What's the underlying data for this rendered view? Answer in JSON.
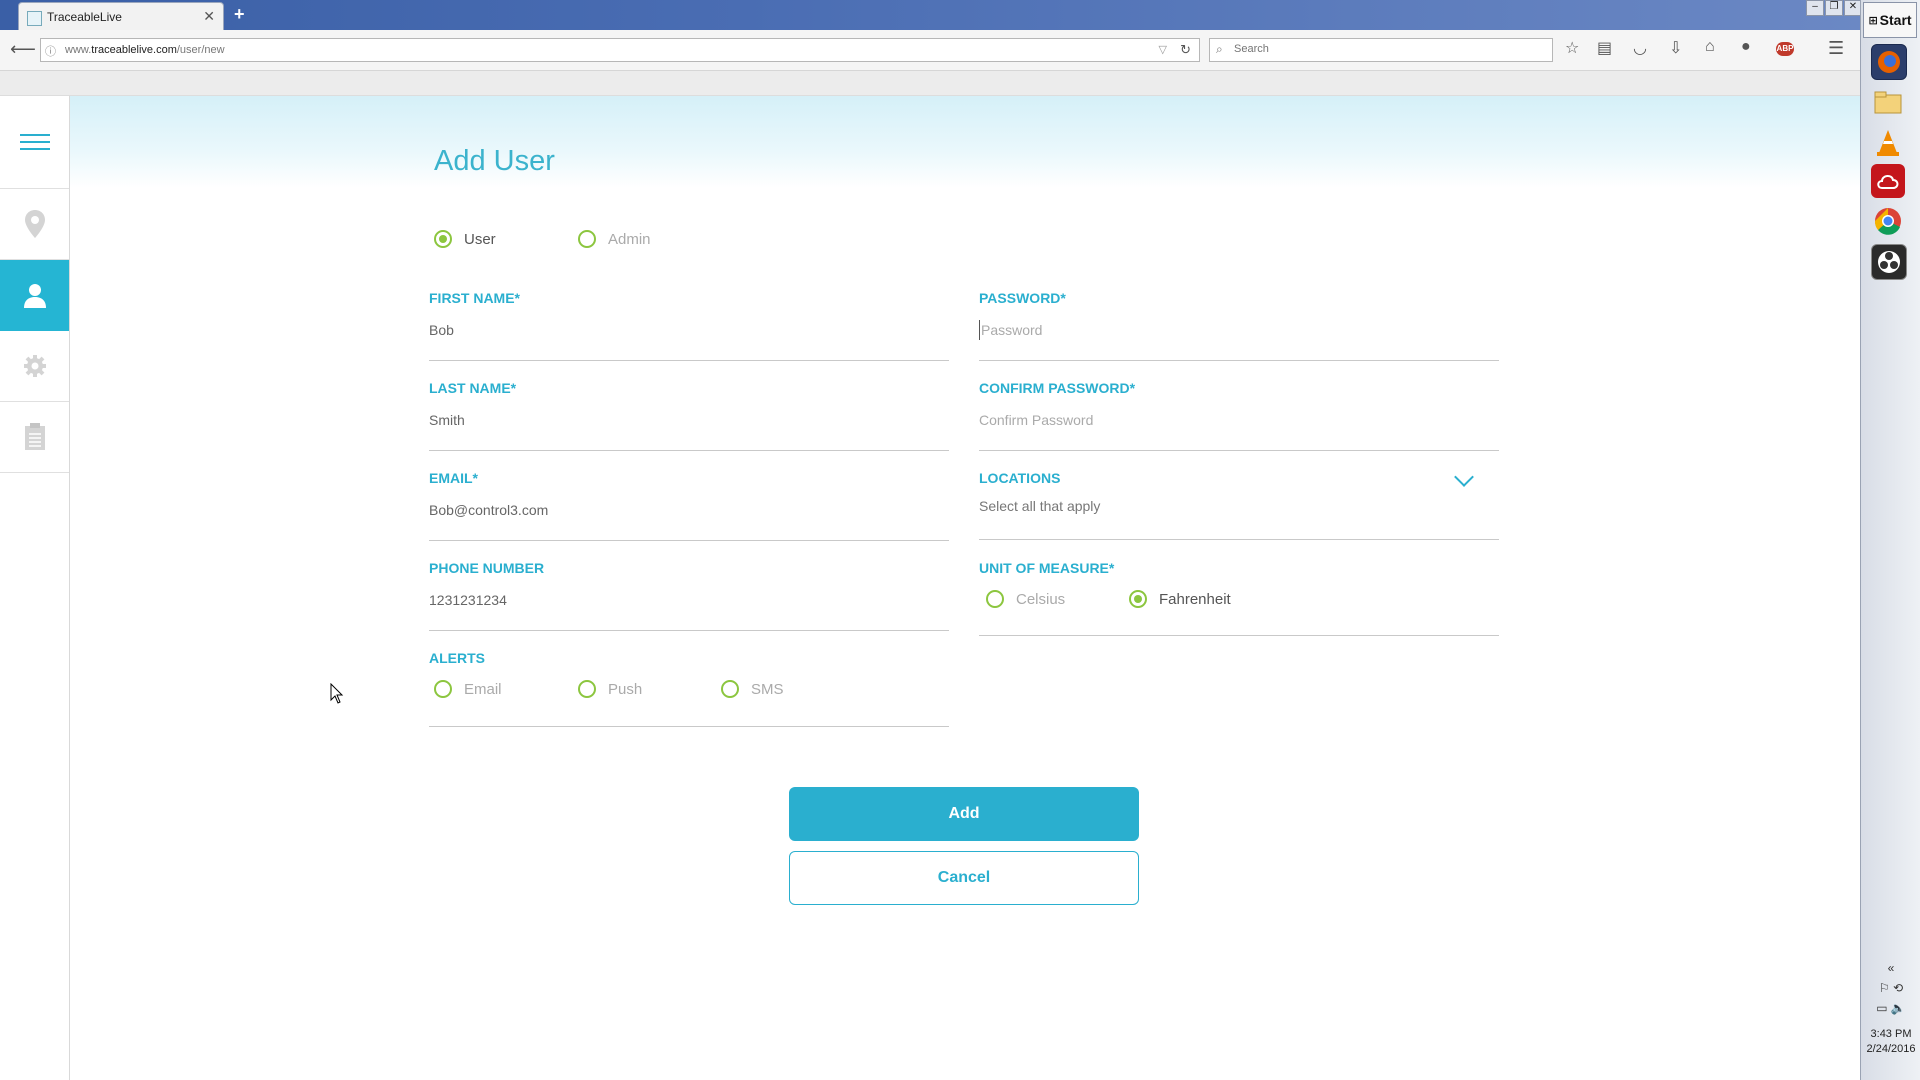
{
  "browser": {
    "tab_title": "TraceableLive",
    "url_prefix": "www.",
    "url_domain": "traceablelive.com",
    "url_path": "/user/new",
    "search_placeholder": "Search",
    "adblock_label": "ABP"
  },
  "app": {
    "page_title": "Add User",
    "sidebar_items": [
      "menu-icon",
      "location-pin-icon",
      "user-icon",
      "gear-icon",
      "clipboard-icon"
    ],
    "active_sidebar_item": "user-icon",
    "role": {
      "options": [
        "User",
        "Admin"
      ],
      "selected": "User"
    },
    "form": {
      "first_name": {
        "label": "FIRST NAME*",
        "value": "Bob"
      },
      "last_name": {
        "label": "LAST NAME*",
        "value": "Smith"
      },
      "email": {
        "label": "EMAIL*",
        "value": "Bob@control3.com"
      },
      "phone": {
        "label": "PHONE NUMBER",
        "value": "1231231234"
      },
      "alerts": {
        "label": "ALERTS",
        "options": [
          "Email",
          "Push",
          "SMS"
        ]
      },
      "password": {
        "label": "PASSWORD*",
        "placeholder": "Password"
      },
      "confirm_password": {
        "label": "CONFIRM PASSWORD*",
        "placeholder": "Confirm Password"
      },
      "locations": {
        "label": "LOCATIONS",
        "hint": "Select all that apply"
      },
      "unit": {
        "label": "UNIT OF MEASURE*",
        "options": [
          "Celsius",
          "Fahrenheit"
        ],
        "selected": "Fahrenheit"
      }
    },
    "add_label": "Add",
    "cancel_label": "Cancel",
    "accent_color": "#2aafcf",
    "radio_color": "#8cc63f"
  },
  "os": {
    "start_label": "Start",
    "clock_time": "3:43 PM",
    "clock_date": "2/24/2016"
  }
}
